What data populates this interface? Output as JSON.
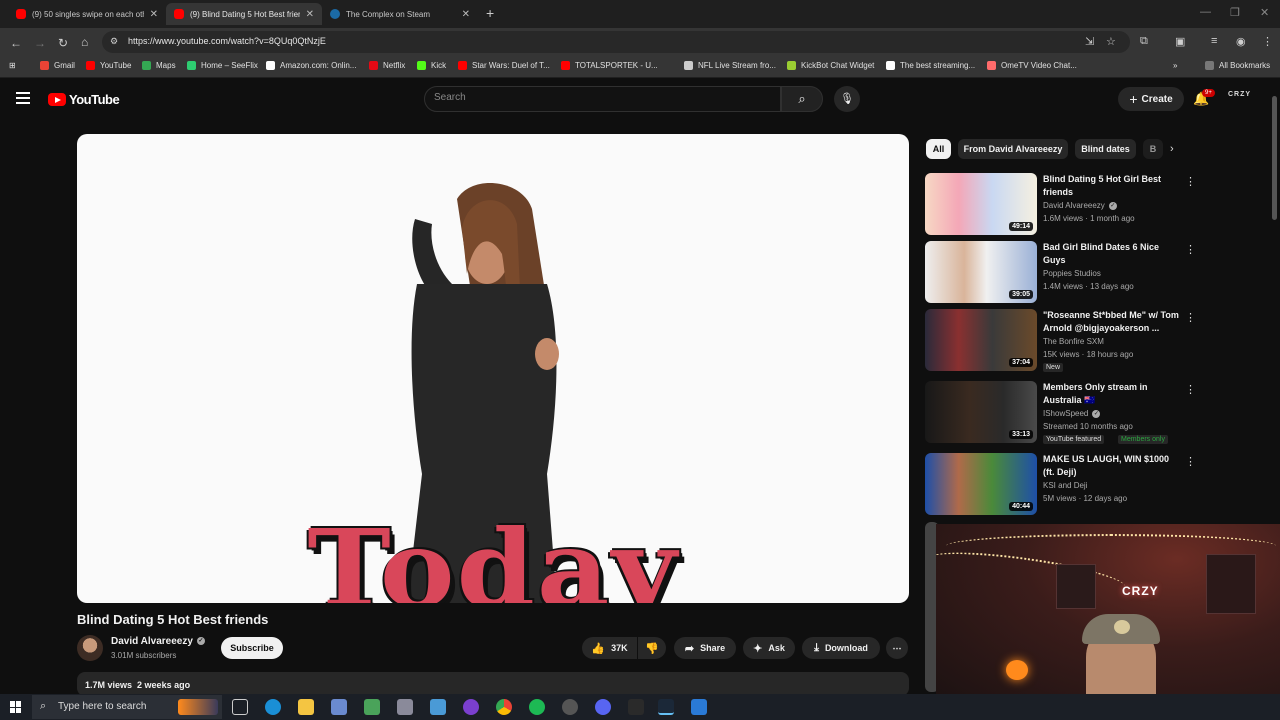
{
  "browser": {
    "tabs": [
      {
        "title": "(9) 50 singles swipe on each oth",
        "favicon": "youtube-icon",
        "active": false
      },
      {
        "title": "(9) Blind Dating 5 Hot Best frien",
        "favicon": "youtube-icon",
        "active": true
      },
      {
        "title": "The Complex on Steam",
        "favicon": "steam-icon",
        "active": false
      }
    ],
    "url": "https://www.youtube.com/watch?v=8QUq0QtNzjE",
    "bookmarks": [
      {
        "label": "Gmail",
        "color": "#ea4335"
      },
      {
        "label": "YouTube",
        "color": "#ff0000"
      },
      {
        "label": "Maps",
        "color": "#34a853"
      },
      {
        "label": "Home – SeeFlix",
        "color": "#2ecc71"
      },
      {
        "label": "Amazon.com: Onlin...",
        "color": "#ffffff"
      },
      {
        "label": "Netflix",
        "color": "#e50914"
      },
      {
        "label": "Kick",
        "color": "#53fc18"
      },
      {
        "label": "Star Wars: Duel of T...",
        "color": "#ff0000"
      },
      {
        "label": "TOTALSPORTEK - U...",
        "color": "#ff0000"
      },
      {
        "label": "NFL Live Stream fro...",
        "color": "#cccccc"
      },
      {
        "label": "KickBot Chat Widget",
        "color": "#9acd32"
      },
      {
        "label": "The best streaming...",
        "color": "#ffffff"
      },
      {
        "label": "OmeTV Video Chat...",
        "color": "#ff6b6b"
      }
    ],
    "all_bookmarks": "All Bookmarks"
  },
  "masthead": {
    "logo_text": "YouTube",
    "search_placeholder": "Search",
    "create_label": "Create",
    "notification_count": "9+",
    "avatar_text": "CRZY"
  },
  "video": {
    "overlay_text": "Today",
    "title": "Blind Dating 5 Hot Best friends",
    "channel": "David Alvareeezy",
    "subscribers": "3.01M subscribers",
    "subscribe_label": "Subscribe",
    "likes": "37K",
    "share_label": "Share",
    "ask_label": "Ask",
    "download_label": "Download",
    "views": "1.7M views",
    "age": "2 weeks ago"
  },
  "sidebar": {
    "chips": [
      "All",
      "From David Alvareeezy",
      "Blind dates",
      "B"
    ],
    "recommendations": [
      {
        "title": "Blind Dating 5 Hot Girl Best friends",
        "channel": "David Alvareeezy",
        "meta": "1.6M views · 1 month ago",
        "duration": "49:14",
        "badge": "",
        "badge2": ""
      },
      {
        "title": "Bad Girl Blind Dates 6 Nice Guys",
        "channel": "Poppies Studios",
        "meta": "1.4M views · 13 days ago",
        "duration": "39:05",
        "badge": "",
        "badge2": ""
      },
      {
        "title": "\"Roseanne St*bbed Me\" w/ Tom Arnold @bigjayoakerson ...",
        "channel": "The Bonfire SXM",
        "meta": "15K views · 18 hours ago",
        "duration": "37:04",
        "badge": "New",
        "badge2": ""
      },
      {
        "title": "Members Only stream in Australia 🇦🇺",
        "channel": "IShowSpeed",
        "meta": "Streamed 10 months ago",
        "duration": "33:13",
        "badge": "YouTube featured",
        "badge2": "Members only"
      },
      {
        "title": "MAKE US LAUGH, WIN $1000 (ft. Deji)",
        "channel": "KSI and Deji",
        "meta": "5M views · 12 days ago",
        "duration": "40:44",
        "badge": "",
        "badge2": ""
      }
    ]
  },
  "webcam": {
    "sign_text": "CRZY"
  },
  "taskbar": {
    "search_placeholder": "Type here to search"
  }
}
